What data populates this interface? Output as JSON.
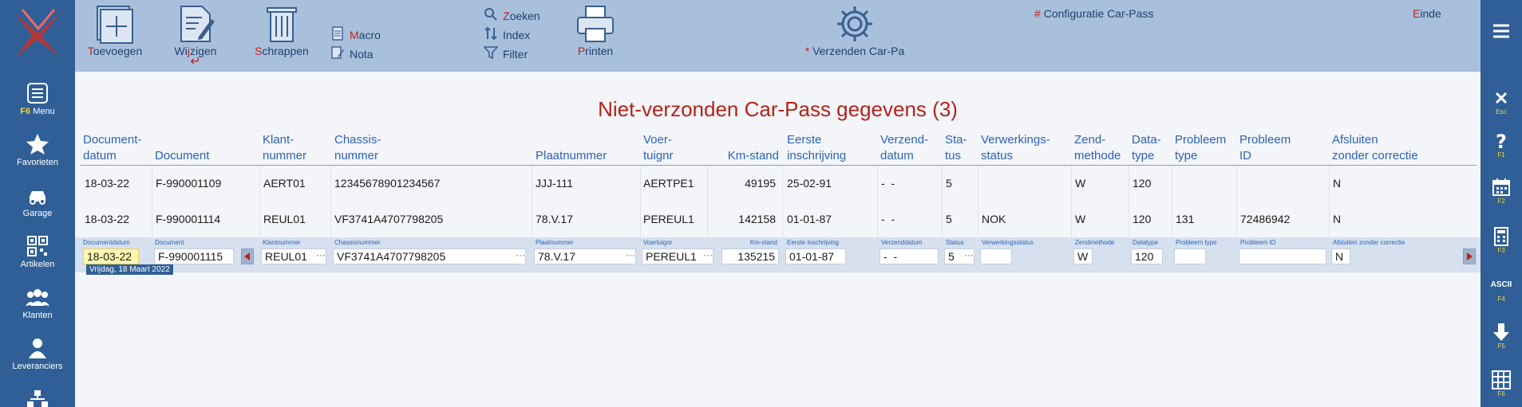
{
  "toolbar": {
    "add": "oevoegen",
    "add_hot": "T",
    "edit_a": "Wi",
    "edit_hot": "j",
    "edit_b": "zigen",
    "delete": "chrappen",
    "delete_hot": "S",
    "macro": "acro",
    "macro_hot": "M",
    "nota": "Nota",
    "search": "oeken",
    "search_hot": "Z",
    "index": "Index",
    "filter": "Filter",
    "print": "rinten",
    "print_hot": "P",
    "send_star": "*",
    "send": "Verzenden Car-Pa",
    "config_hash": "#",
    "config": "Configuratie Car-Pass",
    "end": "inde",
    "end_hot": "E"
  },
  "sidebar": {
    "menu": "Menu",
    "menu_key": "F6",
    "favorites": "Favorieten",
    "garage": "Garage",
    "articles": "Artikelen",
    "customers": "Klanten",
    "suppliers": "Leveranciers"
  },
  "rsidebar": {
    "esc": "Esc",
    "f1": "F1",
    "f2": "F2",
    "f3": "F3",
    "ascii": "ASCII",
    "f4": "F4",
    "f5": "F5",
    "f6": "F6"
  },
  "title": "Niet-verzonden Car-Pass gegevens (3)",
  "headers": {
    "docdate": [
      "Document-",
      "datum"
    ],
    "doc": [
      "",
      "Document"
    ],
    "client": [
      "Klant-",
      "nummer"
    ],
    "chassis": [
      "Chassis-",
      "nummer"
    ],
    "plate": [
      "",
      "Plaatnummer"
    ],
    "vehicle": [
      "Voer-",
      "tuignr"
    ],
    "km": [
      "",
      "Km-stand"
    ],
    "firstreg": [
      "Eerste",
      "inschrijving"
    ],
    "senddate": [
      "Verzend-",
      "datum"
    ],
    "status": [
      "Sta-",
      "tus"
    ],
    "procstatus": [
      "Verwerkings-",
      "status"
    ],
    "sendmethod": [
      "Zend-",
      "methode"
    ],
    "datatype": [
      "Data-",
      "type"
    ],
    "probtype": [
      "Probleem",
      "type"
    ],
    "probid": [
      "Probleem",
      "ID"
    ],
    "close": [
      "Afsluiten",
      "zonder correctie"
    ]
  },
  "rows": [
    {
      "docdate": "18-03-22",
      "doc": "F-990001109",
      "client": "AERT01",
      "chassis": "12345678901234567",
      "plate": "JJJ-111",
      "vehicle": "AERTPE1",
      "km": "49195",
      "firstreg": "25-02-91",
      "senddate": "-  -",
      "status": "5",
      "procstatus": "",
      "sendmethod": "W",
      "datatype": "120",
      "probtype": "",
      "probid": "",
      "close": "N"
    },
    {
      "docdate": "18-03-22",
      "doc": "F-990001114",
      "client": "REUL01",
      "chassis": "VF3741A4707798205",
      "plate": "78.V.17",
      "vehicle": "PEREUL1",
      "km": "142158",
      "firstreg": "01-01-87",
      "senddate": "-  -",
      "status": "5",
      "procstatus": "NOK",
      "sendmethod": "W",
      "datatype": "120",
      "probtype": "131",
      "probid": "72486942",
      "close": "N"
    }
  ],
  "edit": {
    "labels": {
      "docdate": "Documentdatum",
      "doc": "Document",
      "client": "Klantnummer",
      "chassis": "Chassisnummer",
      "plate": "Plaatnummer",
      "vehicle": "Voertuignr",
      "km": "Km-stand",
      "firstreg": "Eerste inschrijving",
      "senddate": "Verzenddatum",
      "status": "Status",
      "procstatus": "Verwerkingsstatus",
      "sendmethod": "Zendmethode",
      "datatype": "Datatype",
      "probtype": "Probleem type",
      "probid": "Probleem ID",
      "close": "Afsluiten zonder correctie"
    },
    "values": {
      "docdate": "18-03-22",
      "doc": "F-990001115",
      "client": "REUL01",
      "chassis": "VF3741A4707798205",
      "plate": "78.V.17",
      "vehicle": "PEREUL1",
      "km": "135215",
      "firstreg": "01-01-87",
      "senddate": "-  -",
      "status": "5",
      "procstatus": "",
      "sendmethod": "W",
      "datatype": "120",
      "probtype": "",
      "probid": "",
      "close": "N"
    },
    "dots": "···",
    "tooltip": "Vrijdag, 18 Maart 2022"
  },
  "colors": {
    "sidebar": "#2f5f96",
    "toolbar": "#a9c0dc",
    "title": "#b52219",
    "header": "#2b63b3",
    "hotkey": "#c0201c"
  }
}
